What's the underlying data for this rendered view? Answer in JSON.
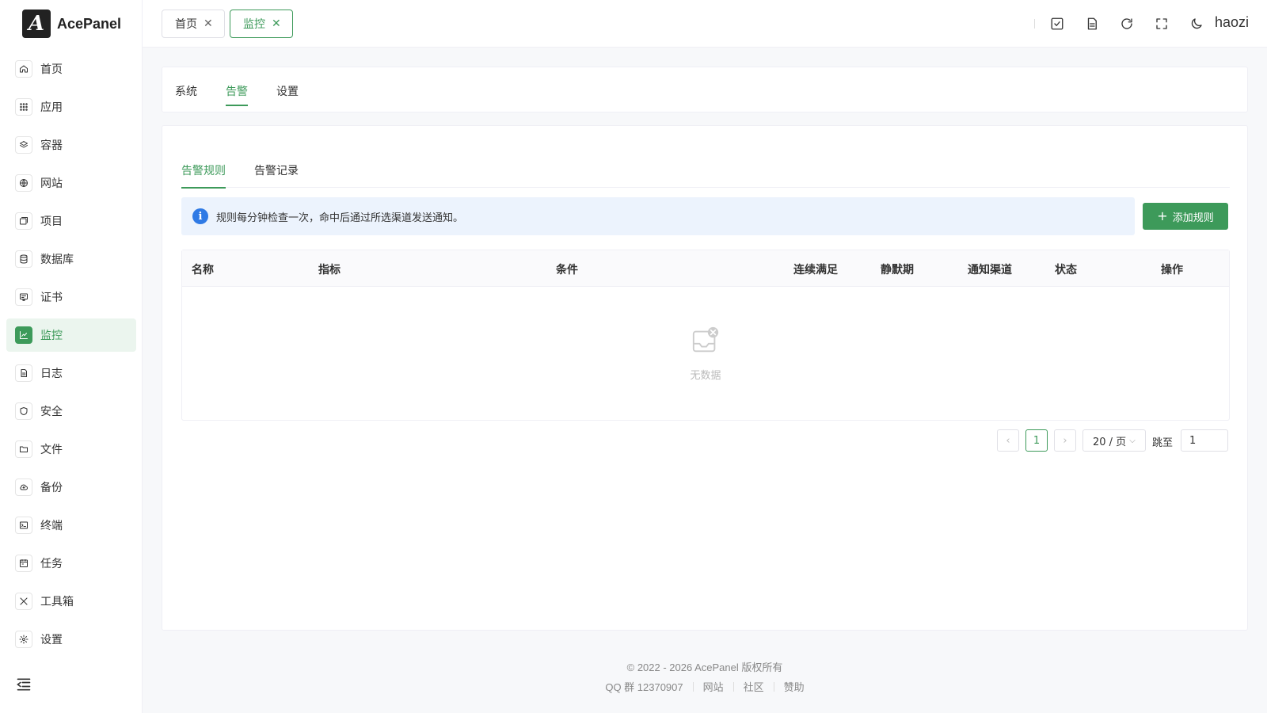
{
  "app": {
    "name": "AcePanel",
    "logo_letter": "A"
  },
  "sidebar": {
    "items": [
      {
        "label": "首页",
        "icon": "home-icon"
      },
      {
        "label": "应用",
        "icon": "apps-icon"
      },
      {
        "label": "容器",
        "icon": "layers-icon"
      },
      {
        "label": "网站",
        "icon": "globe-icon"
      },
      {
        "label": "项目",
        "icon": "project-icon"
      },
      {
        "label": "数据库",
        "icon": "database-icon"
      },
      {
        "label": "证书",
        "icon": "certificate-icon"
      },
      {
        "label": "监控",
        "icon": "chart-icon"
      },
      {
        "label": "日志",
        "icon": "log-icon"
      },
      {
        "label": "安全",
        "icon": "shield-icon"
      },
      {
        "label": "文件",
        "icon": "folder-icon"
      },
      {
        "label": "备份",
        "icon": "cloud-icon"
      },
      {
        "label": "终端",
        "icon": "terminal-icon"
      },
      {
        "label": "任务",
        "icon": "task-icon"
      },
      {
        "label": "工具箱",
        "icon": "tools-icon"
      },
      {
        "label": "设置",
        "icon": "gear-icon"
      }
    ],
    "active": "监控"
  },
  "header": {
    "tabs": [
      {
        "label": "首页"
      },
      {
        "label": "监控"
      }
    ],
    "username": "haozi"
  },
  "page_tabs": [
    "系统",
    "告警",
    "设置"
  ],
  "sub_tabs": [
    "告警规则",
    "告警记录"
  ],
  "alert_text": "规则每分钟检查一次，命中后通过所选渠道发送通知。",
  "add_button": "添加规则",
  "table": {
    "columns": [
      "名称",
      "指标",
      "条件",
      "连续满足",
      "静默期",
      "通知渠道",
      "状态",
      "操作"
    ],
    "empty_text": "无数据"
  },
  "pager": {
    "current": "1",
    "page_size": "20 / 页",
    "jump_label": "跳至",
    "jump_value": "1"
  },
  "footer": {
    "copyright": "© 2022 - 2026 AcePanel 版权所有",
    "qq": "QQ 群 12370907",
    "links": [
      "网站",
      "社区",
      "赞助"
    ]
  },
  "colors": {
    "accent": "#3d9a5a",
    "info": "#2f7ae5"
  }
}
